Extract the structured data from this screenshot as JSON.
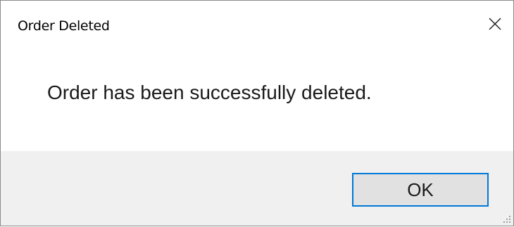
{
  "window": {
    "title": "Order Deleted",
    "close_icon": "close-icon"
  },
  "content": {
    "message": "Order has been successfully deleted."
  },
  "footer": {
    "ok_label": "OK",
    "resize_grip_icon": "resize-grip-icon"
  },
  "colors": {
    "button_border": "#0078d7",
    "button_fill": "#e1e1e1",
    "footer_bg": "#f0f0f0"
  }
}
